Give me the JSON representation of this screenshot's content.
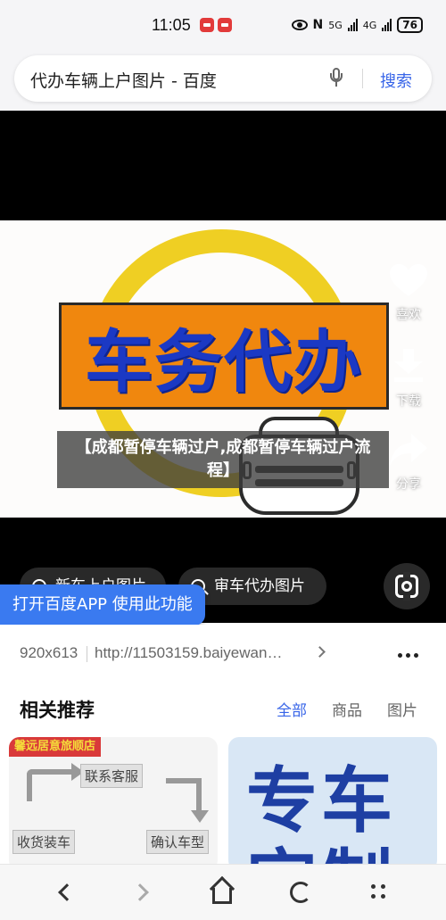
{
  "status_bar": {
    "time": "11:05",
    "network_5g": "5G",
    "network_4g": "4G",
    "battery": "76"
  },
  "search": {
    "query": "代办车辆上户图片 - 百度",
    "button": "搜索"
  },
  "viewer": {
    "image_banner_text": "车务代办",
    "caption": "【成都暂停车辆过户,成都暂停车辆过户流程】",
    "actions": {
      "like": "喜欢",
      "download": "下载",
      "share": "分享"
    },
    "chips": [
      "新车上户图片",
      "审车代办图片"
    ],
    "open_app": "打开百度APP 使用此功能"
  },
  "info": {
    "size": "920x613",
    "url": "http://11503159.baiyewan…"
  },
  "related": {
    "title": "相关推荐",
    "tabs": [
      "全部",
      "商品",
      "图片"
    ],
    "active_tab": "全部",
    "cards": {
      "left": {
        "tag": "馨远居意旅顺店",
        "steps": [
          "联系客服",
          "收货装车",
          "确认车型"
        ]
      },
      "right": {
        "text": "专车定制"
      }
    }
  },
  "colors": {
    "accent": "#3865e8",
    "open_app_bg": "#3a7af0",
    "banner_orange": "#f0870e",
    "banner_text": "#1b39c4",
    "ring_yellow": "#efcf23"
  }
}
